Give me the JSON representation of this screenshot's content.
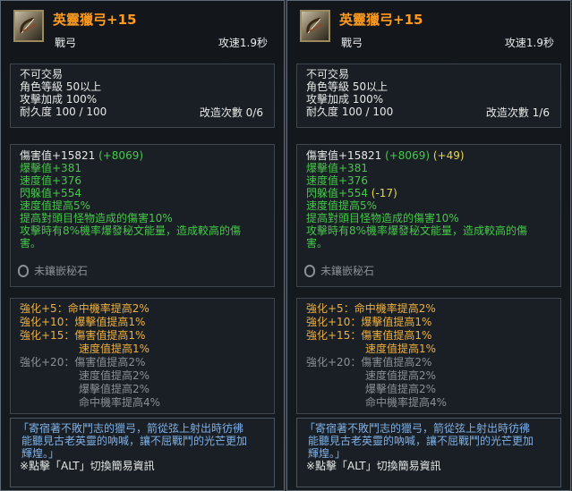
{
  "panels": [
    {
      "item_name": "英靈獵弓+15",
      "weapon_type": "戰弓",
      "attack_speed": "攻速1.9秒",
      "basic": [
        "不可交易",
        "角色等級 50以上",
        "攻擊加成 100%",
        "耐久度 100 / 100"
      ],
      "reform": "改造次數 0/6",
      "damage_main": "傷害值+15821",
      "damage_bonus": "(+8069)",
      "damage_extra": "",
      "stats": [
        {
          "text": "爆擊值+381",
          "extra": ""
        },
        {
          "text": "速度值+376",
          "extra": ""
        },
        {
          "text": "閃躲值+554",
          "extra": ""
        },
        {
          "text": "速度值提高5%",
          "extra": ""
        }
      ],
      "effects": [
        "提高對頭目怪物造成的傷害10%",
        "攻擊時有8%機率爆發秘文能量，造成較高的傷",
        "害。"
      ],
      "gem": "未鑲嵌秘石",
      "enhance": [
        {
          "label": "強化+5：",
          "text": "命中機率提高2%",
          "active": true
        },
        {
          "label": "強化+10：",
          "text": "爆擊值提高1%",
          "active": true
        },
        {
          "label": "強化+15：",
          "text": "傷害值提高1%",
          "active": true
        },
        {
          "label": "",
          "text": "速度值提高1%",
          "active": true
        },
        {
          "label": "強化+20：",
          "text": "傷害值提高2%",
          "active": false
        },
        {
          "label": "",
          "text": "速度值提高2%",
          "active": false
        },
        {
          "label": "",
          "text": "爆擊值提高2%",
          "active": false
        },
        {
          "label": "",
          "text": "命中機率提高4%",
          "active": false
        }
      ],
      "lore": [
        "「寄宿著不敗鬥志的獵弓，箭從弦上射出時彷彿",
        "能聽見古老英靈的吶喊，讓不屈戰鬥的光芒更加",
        "輝煌。」"
      ],
      "hint": "※點擊「ALT」切換簡易資訊"
    },
    {
      "item_name": "英靈獵弓+15",
      "weapon_type": "戰弓",
      "attack_speed": "攻速1.9秒",
      "basic": [
        "不可交易",
        "角色等級 50以上",
        "攻擊加成 100%",
        "耐久度 100 / 100"
      ],
      "reform": "改造次數 1/6",
      "damage_main": "傷害值+15821",
      "damage_bonus": "(+8069)",
      "damage_extra": "(+49)",
      "stats": [
        {
          "text": "爆擊值+381",
          "extra": ""
        },
        {
          "text": "速度值+376",
          "extra": ""
        },
        {
          "text": "閃躲值+554",
          "extra": "(-17)"
        },
        {
          "text": "速度值提高5%",
          "extra": ""
        }
      ],
      "effects": [
        "提高對頭目怪物造成的傷害10%",
        "攻擊時有8%機率爆發秘文能量，造成較高的傷",
        "害。"
      ],
      "gem": "未鑲嵌秘石",
      "enhance": [
        {
          "label": "強化+5：",
          "text": "命中機率提高2%",
          "active": true
        },
        {
          "label": "強化+10：",
          "text": "爆擊值提高1%",
          "active": true
        },
        {
          "label": "強化+15：",
          "text": "傷害值提高1%",
          "active": true
        },
        {
          "label": "",
          "text": "速度值提高1%",
          "active": true
        },
        {
          "label": "強化+20：",
          "text": "傷害值提高2%",
          "active": false
        },
        {
          "label": "",
          "text": "速度值提高2%",
          "active": false
        },
        {
          "label": "",
          "text": "爆擊值提高2%",
          "active": false
        },
        {
          "label": "",
          "text": "命中機率提高4%",
          "active": false
        }
      ],
      "lore": [
        "「寄宿著不敗鬥志的獵弓，箭從弦上射出時彷彿",
        "能聽見古老英靈的吶喊，讓不屈戰鬥的光芒更加",
        "輝煌。」"
      ],
      "hint": "※點擊「ALT」切換簡易資訊"
    }
  ],
  "icons": {
    "item": "bow-icon",
    "gem": "gem-socket-icon"
  },
  "colors": {
    "title": "#ff9c1f",
    "green_stat": "#46c84a",
    "bonus_yellow": "#e8d84c",
    "enhance_active": "#f0b040",
    "inactive": "#8b9095",
    "lore": "#7fb0e8"
  }
}
